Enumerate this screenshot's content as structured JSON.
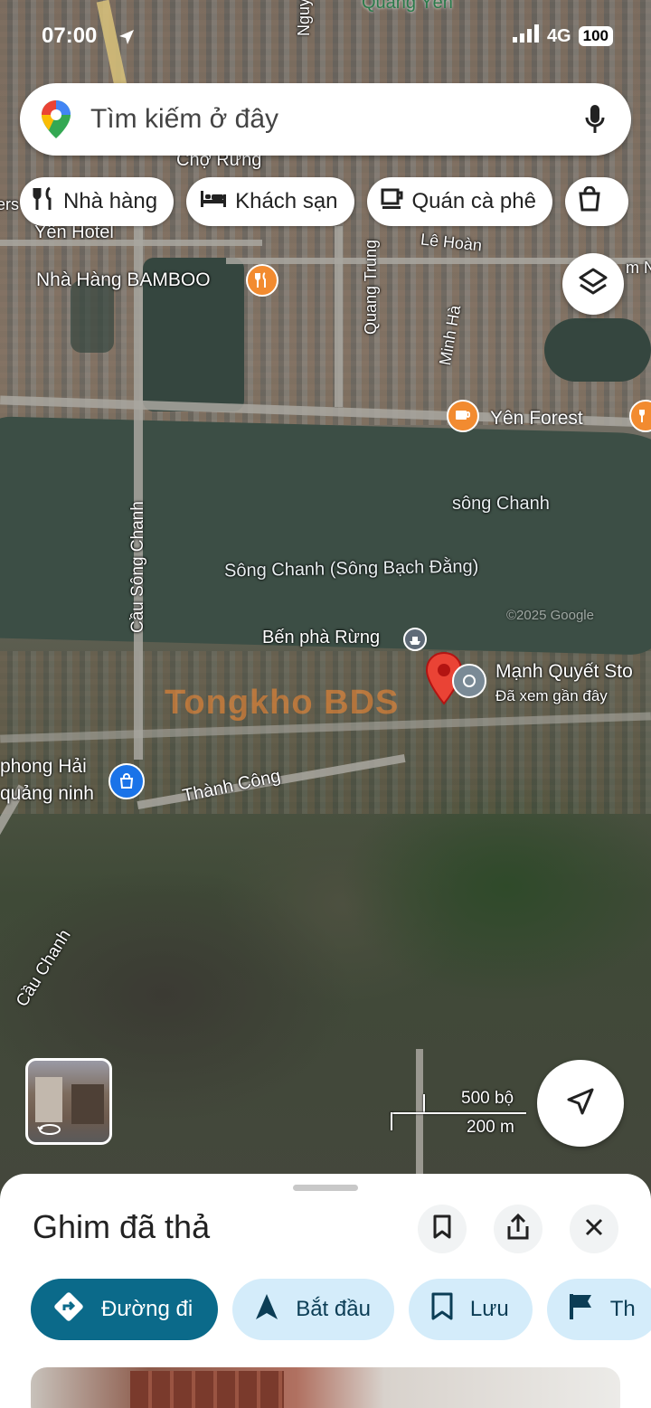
{
  "status": {
    "time": "07:00",
    "network": "4G",
    "battery": "100"
  },
  "search": {
    "placeholder": "Tìm kiếm ở đây"
  },
  "chips": [
    {
      "label": "Nhà hàng",
      "icon": "fork-knife-icon"
    },
    {
      "label": "Khách sạn",
      "icon": "bed-icon"
    },
    {
      "label": "Quán cà phê",
      "icon": "coffee-icon"
    }
  ],
  "map_labels": {
    "quang_yen": "Quảng Yên",
    "nguyen": "Nguyễn",
    "cho_rung": "Chợ Rừng",
    "yen_hotel": "Yên Hotel",
    "ers": "ers",
    "bamboo": "Nhà Hàng BAMBOO",
    "quang_trung": "Quang Trung",
    "le_hoan": "Lê Hoàn",
    "minh_ha": "Minh Hà",
    "m_n": "m N",
    "yen_forest": "Yên Forest",
    "song_chanh": "sông Chanh",
    "song_chanh_full": "Sông Chanh (Sông Bạch Đằng)",
    "cau_song_chanh": "Cầu Sông Chanh",
    "ben_pha": "Bến phà Rừng",
    "manh_quyet": "Mạnh Quyết Sto",
    "da_xem": "Đã xem gần đây",
    "phong_hai": "phong Hải",
    "quang_ninh": "quảng ninh",
    "thanh_cong": "Thành Công",
    "cau_chanh": "Cầu Chanh",
    "watermark": "Tongkho BDS",
    "google_wm": "©2025 Google"
  },
  "scale": {
    "imperial": "500 bộ",
    "metric": "200 m"
  },
  "sheet": {
    "title": "Ghim đã thả",
    "actions": [
      {
        "label": "Đường đi"
      },
      {
        "label": "Bắt đầu"
      },
      {
        "label": "Lưu"
      },
      {
        "label": "Th"
      }
    ]
  },
  "colors": {
    "primary": "#0b6a8a",
    "secondary_action": "#d4ecfa",
    "pin": "#ea4335",
    "poi_orange": "#f28b30",
    "poi_blue": "#1a73e8"
  }
}
